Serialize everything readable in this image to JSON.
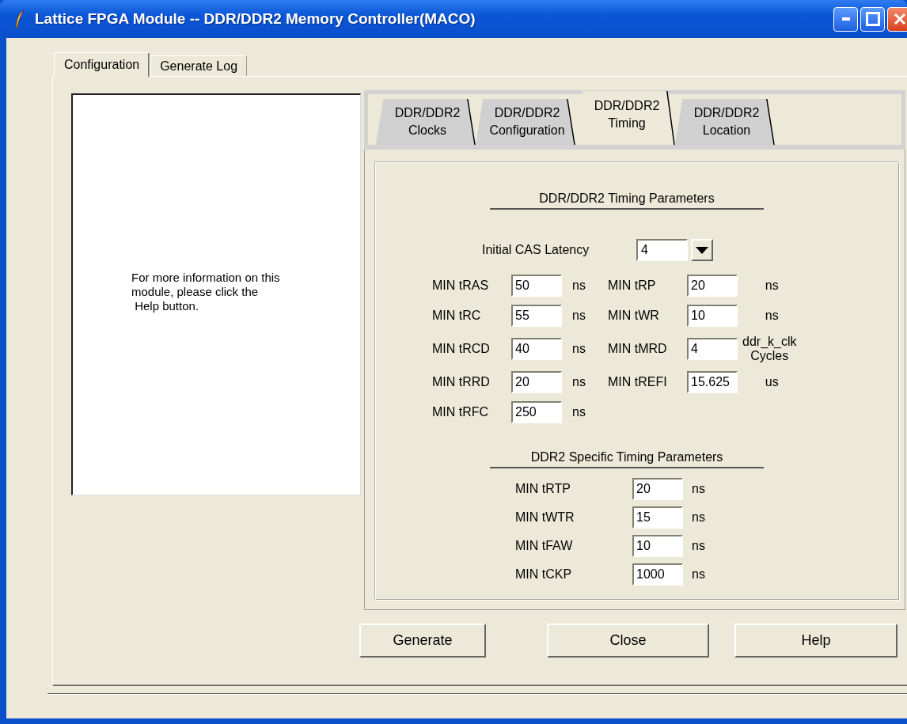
{
  "window": {
    "title": "Lattice FPGA Module -- DDR/DDR2 Memory Controller(MACO)"
  },
  "tabs": [
    {
      "label": "Configuration",
      "selected": true
    },
    {
      "label": "Generate Log",
      "selected": false
    }
  ],
  "help_text": "For more information on this\nmodule, please click the\n Help button.",
  "subtabs": [
    {
      "label": "DDR/DDR2\nClocks",
      "selected": false
    },
    {
      "label": "DDR/DDR2\nConfiguration",
      "selected": false
    },
    {
      "label": "DDR/DDR2\nTiming",
      "selected": true
    },
    {
      "label": "DDR/DDR2\nLocation",
      "selected": false
    }
  ],
  "timing": {
    "title": "DDR/DDR2 Timing Parameters",
    "cas_latency": {
      "label": "Initial CAS Latency",
      "value": "4"
    },
    "rows": [
      {
        "left": {
          "label": "MIN tRAS",
          "value": "50",
          "unit": "ns"
        },
        "right": {
          "label": "MIN tRP",
          "value": "20",
          "unit": "ns"
        }
      },
      {
        "left": {
          "label": "MIN tRC",
          "value": "55",
          "unit": "ns"
        },
        "right": {
          "label": "MIN tWR",
          "value": "10",
          "unit": "ns"
        }
      },
      {
        "left": {
          "label": "MIN tRCD",
          "value": "40",
          "unit": "ns"
        },
        "right": {
          "label": "MIN tMRD",
          "value": "4",
          "unit": "ddr_k_clk\nCycles"
        }
      },
      {
        "left": {
          "label": "MIN tRRD",
          "value": "20",
          "unit": "ns"
        },
        "right": {
          "label": "MIN tREFI",
          "value": "15.625",
          "unit": "us"
        }
      },
      {
        "left": {
          "label": "MIN tRFC",
          "value": "250",
          "unit": "ns"
        }
      }
    ]
  },
  "ddr2": {
    "title": "DDR2 Specific Timing Parameters",
    "params": [
      {
        "label": "MIN tRTP",
        "value": "20",
        "unit": "ns"
      },
      {
        "label": "MIN tWTR",
        "value": "15",
        "unit": "ns"
      },
      {
        "label": "MIN tFAW",
        "value": "10",
        "unit": "ns"
      },
      {
        "label": "MIN tCKP",
        "value": "1000",
        "unit": "ns"
      }
    ]
  },
  "buttons": [
    "Generate",
    "Close",
    "Help"
  ]
}
